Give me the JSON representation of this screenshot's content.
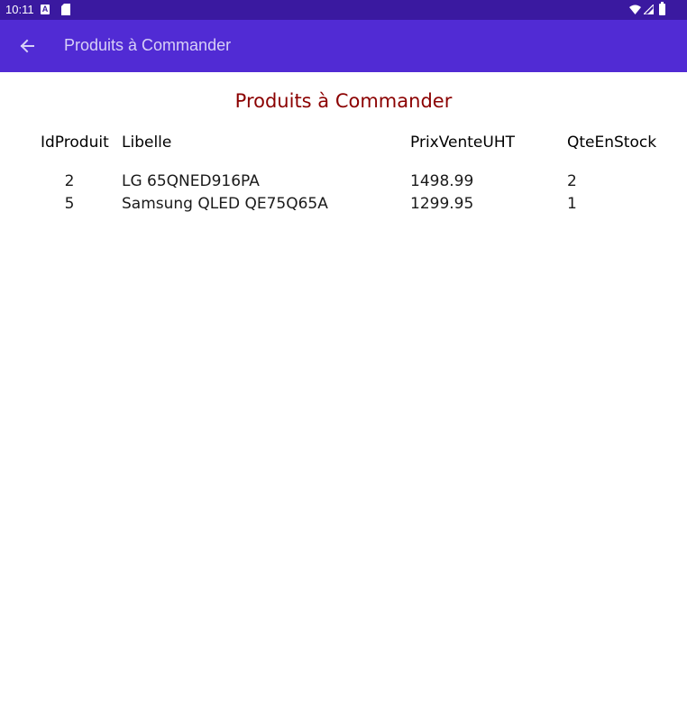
{
  "status_bar": {
    "time": "10:11",
    "a_badge": "A",
    "icons": [
      "a-icon",
      "sd-card-icon",
      "wifi-icon",
      "signal-icon",
      "battery-icon"
    ]
  },
  "app_bar": {
    "title": "Produits à Commander",
    "back_icon": "arrow-left-icon",
    "background": "#512bd4"
  },
  "page": {
    "heading": "Produits à Commander",
    "heading_color": "#8b0000"
  },
  "table": {
    "headers": [
      "IdProduit",
      "Libelle",
      "PrixVenteUHT",
      "QteEnStock"
    ],
    "rows": [
      [
        "2",
        "LG 65QNED916PA",
        "1498.99",
        "2"
      ],
      [
        "5",
        "Samsung QLED QE75Q65A",
        "1299.95",
        "1"
      ]
    ]
  }
}
